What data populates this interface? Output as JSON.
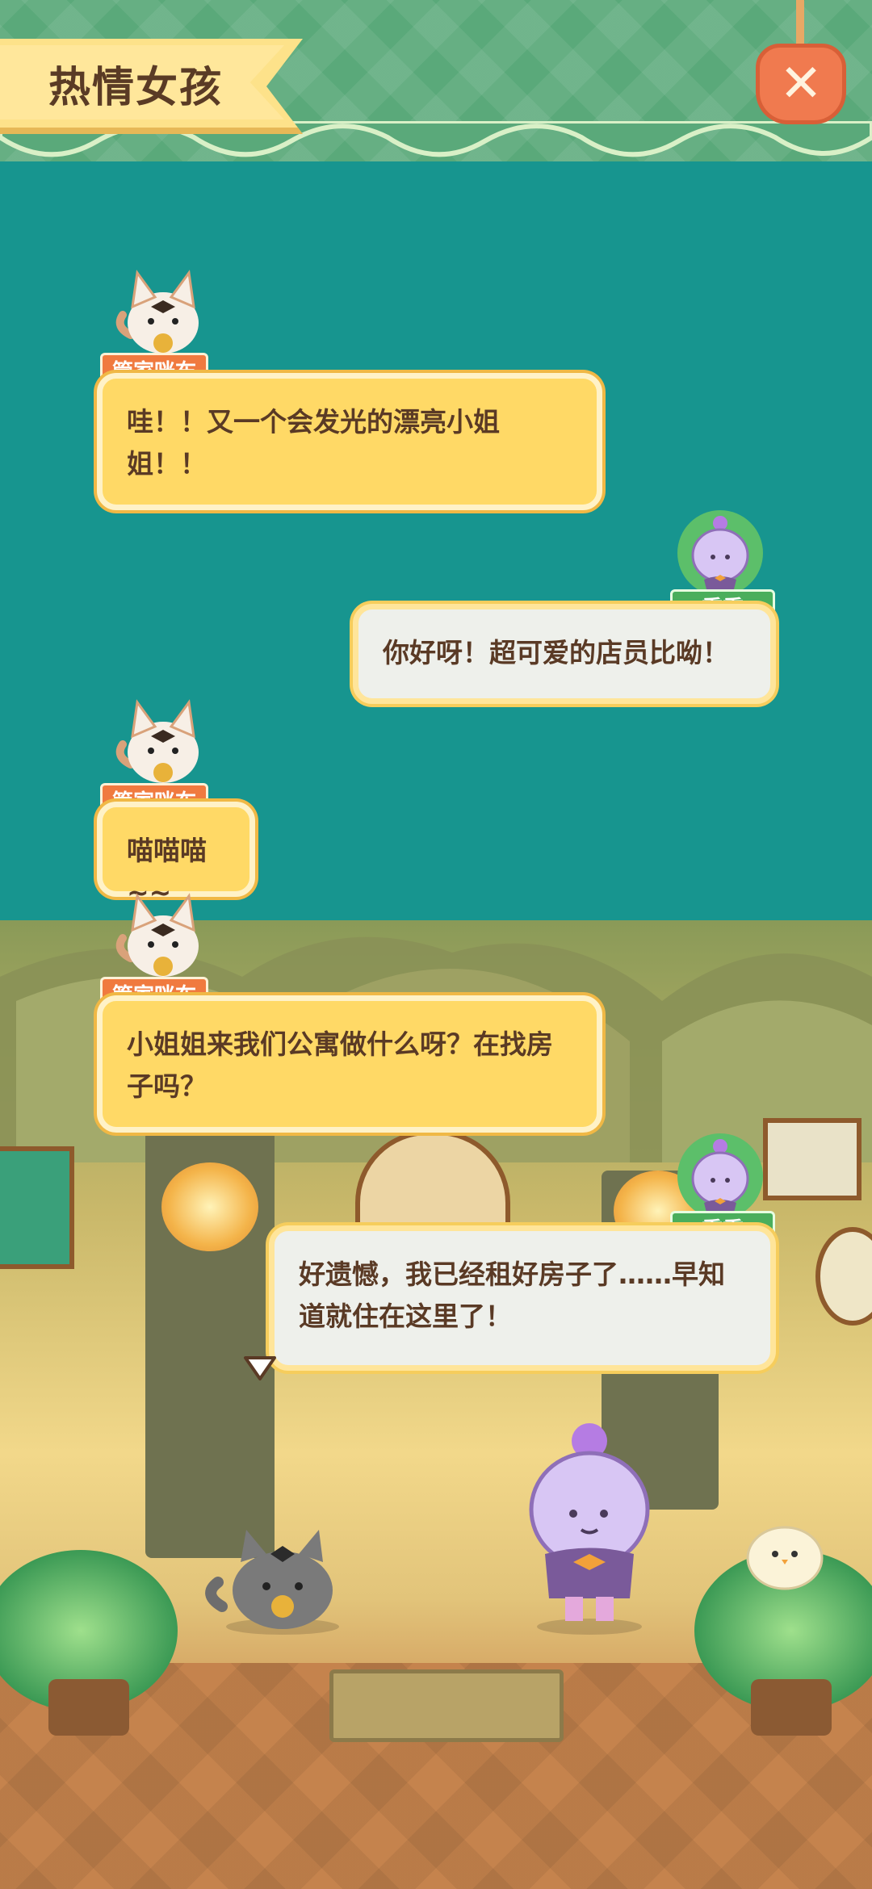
{
  "header": {
    "title": "热情女孩",
    "close_icon": "close-x-icon"
  },
  "colors": {
    "sea": "#17958f",
    "banner_green": "#5aa97a",
    "cat_tag": "#f07a3f",
    "candle_tag": "#4aae5c",
    "bubble_yellow": "#ffd966",
    "bubble_gray": "#eef0eb"
  },
  "dialogue": [
    {
      "speaker": "管家咪布",
      "avatar": "cat-avatar-icon",
      "text": "哇！！又一个会发光的漂亮小姐姐！！"
    },
    {
      "speaker": "熏熏",
      "avatar": "candle-avatar-icon",
      "text": "你好呀！超可爱的店员比呦！"
    },
    {
      "speaker": "管家咪布",
      "avatar": "cat-avatar-icon",
      "text": "喵喵喵~~"
    },
    {
      "speaker": "管家咪布",
      "avatar": "cat-avatar-icon",
      "text": "小姐姐来我们公寓做什么呀？在找房子吗？"
    },
    {
      "speaker": "熏熏",
      "avatar": "candle-avatar-icon",
      "text": "好遗憾，我已经租好房子了……早知道就住在这里了！"
    }
  ],
  "scene": {
    "continue_icon": "triangle-down-icon"
  }
}
